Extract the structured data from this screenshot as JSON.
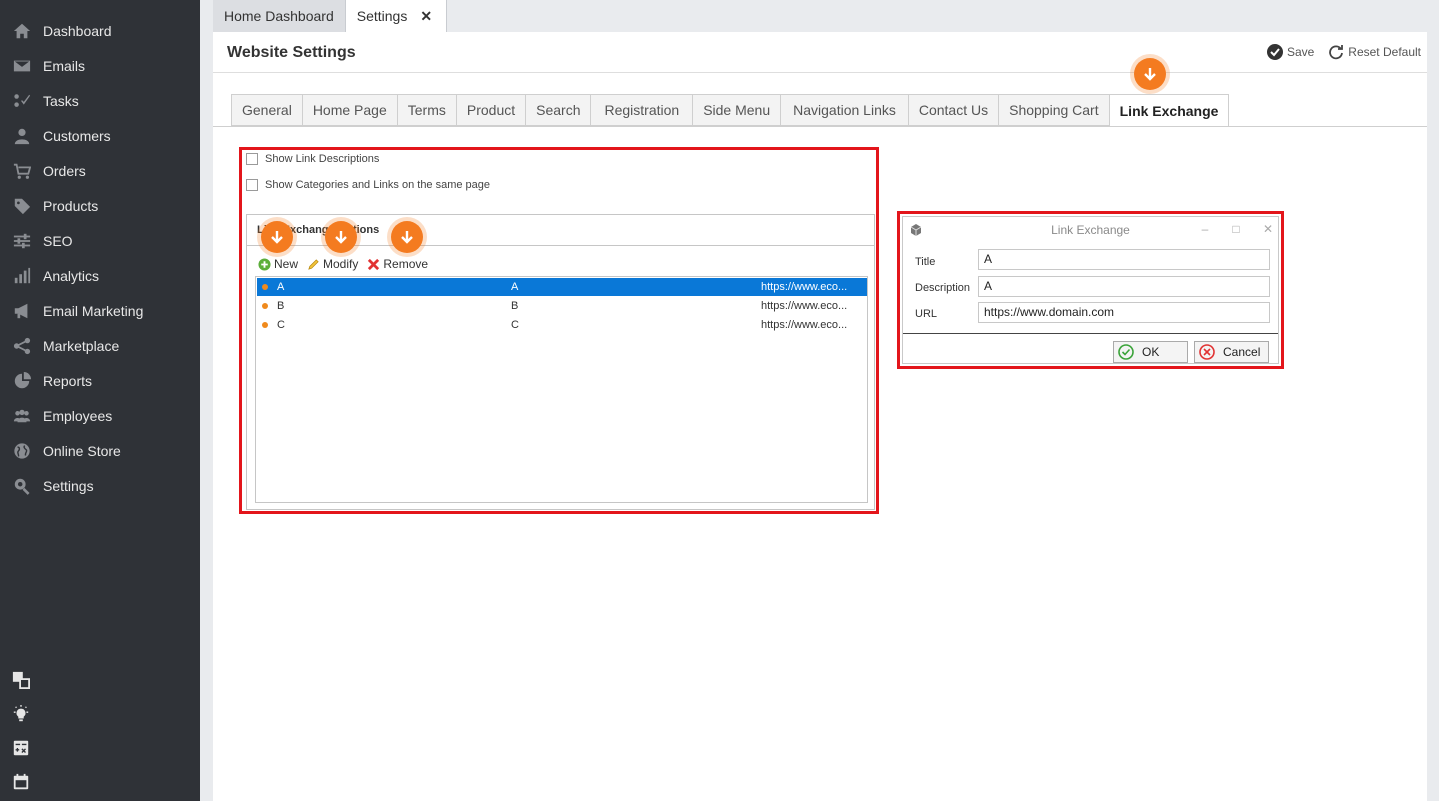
{
  "sidebar": {
    "items": [
      {
        "label": "Dashboard",
        "icon": "home-icon"
      },
      {
        "label": "Emails",
        "icon": "envelope-icon"
      },
      {
        "label": "Tasks",
        "icon": "tasks-icon"
      },
      {
        "label": "Customers",
        "icon": "user-icon"
      },
      {
        "label": "Orders",
        "icon": "cart-icon"
      },
      {
        "label": "Products",
        "icon": "tag-icon"
      },
      {
        "label": "SEO",
        "icon": "sliders-icon"
      },
      {
        "label": "Analytics",
        "icon": "bar-chart-icon"
      },
      {
        "label": "Email Marketing",
        "icon": "megaphone-icon"
      },
      {
        "label": "Marketplace",
        "icon": "share-icon"
      },
      {
        "label": "Reports",
        "icon": "pie-chart-icon"
      },
      {
        "label": "Employees",
        "icon": "users-icon"
      },
      {
        "label": "Online Store",
        "icon": "globe-icon"
      },
      {
        "label": "Settings",
        "icon": "gear-search-icon"
      }
    ],
    "bottom_icons": [
      "windows-icon",
      "lightbulb-icon",
      "calculator-icon",
      "calendar-icon"
    ]
  },
  "doc_tabs": [
    {
      "label": "Home Dashboard"
    },
    {
      "label": "Settings",
      "close": "✕"
    }
  ],
  "header": {
    "title": "Website Settings",
    "save_label": "Save",
    "reset_label": "Reset Default"
  },
  "settings_tabs": [
    "General",
    "Home Page",
    "Terms",
    "Product",
    "Search",
    "Registration",
    "Side Menu",
    "Navigation Links",
    "Contact Us",
    "Shopping Cart",
    "Link Exchange"
  ],
  "active_settings_tab": "Link Exchange",
  "options": {
    "show_link_descriptions": "Show Link Descriptions",
    "show_categories_same_page": "Show Categories and Links on the same page"
  },
  "group": {
    "title": "Link Exchange Options"
  },
  "toolbar": {
    "new_label": "New",
    "modify_label": "Modify",
    "remove_label": "Remove"
  },
  "grid_rows": [
    {
      "title": "A",
      "description": "A",
      "url": "https://www.eco..."
    },
    {
      "title": "B",
      "description": "B",
      "url": "https://www.eco..."
    },
    {
      "title": "C",
      "description": "C",
      "url": "https://www.eco..."
    }
  ],
  "dialog": {
    "title": "Link Exchange",
    "title_label": "Title",
    "title_value": "A",
    "description_label": "Description",
    "description_value": "A",
    "url_label": "URL",
    "url_value": "https://www.domain.com",
    "ok_label": "OK",
    "cancel_label": "Cancel"
  },
  "colors": {
    "sidebar_bg": "#2f3237",
    "accent_orange": "#f47b20",
    "highlight_red": "#e3151b",
    "selection_blue": "#0a78d7"
  }
}
